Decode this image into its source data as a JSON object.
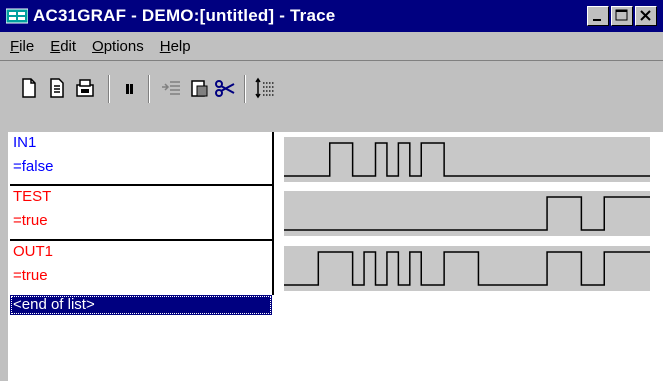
{
  "window": {
    "title": "AC31GRAF - DEMO:[untitled] - Trace"
  },
  "menu": [
    {
      "key": "F",
      "rest": "ile"
    },
    {
      "key": "E",
      "rest": "dit"
    },
    {
      "key": "O",
      "rest": "ptions"
    },
    {
      "key": "H",
      "rest": "elp"
    }
  ],
  "toolbar": {
    "icons": [
      "new-file-icon",
      "open-file-icon",
      "print-icon",
      "pause-icon",
      "insert-row-icon",
      "paste-icon",
      "cut-icon",
      "timescale-icon"
    ]
  },
  "signals": [
    {
      "name": "IN1",
      "value": "=false",
      "color": "#0000ff",
      "levels": [
        0,
        0,
        0,
        0,
        1,
        1,
        0,
        0,
        1,
        0,
        1,
        0,
        1,
        1,
        0,
        0,
        0,
        0,
        0,
        0,
        0,
        0,
        0,
        0,
        0,
        0,
        0,
        0,
        0,
        0,
        0,
        0
      ]
    },
    {
      "name": "TEST",
      "value": "=true",
      "color": "#ff0000",
      "levels": [
        0,
        0,
        0,
        0,
        0,
        0,
        0,
        0,
        0,
        0,
        0,
        0,
        0,
        0,
        0,
        0,
        0,
        0,
        0,
        0,
        0,
        0,
        0,
        1,
        1,
        1,
        0,
        0,
        1,
        1,
        1,
        1
      ]
    },
    {
      "name": "OUT1",
      "value": "=true",
      "color": "#ff0000",
      "levels": [
        0,
        0,
        0,
        1,
        1,
        1,
        0,
        1,
        0,
        1,
        0,
        1,
        0,
        0,
        1,
        1,
        1,
        0,
        0,
        0,
        0,
        0,
        0,
        1,
        1,
        1,
        0,
        0,
        1,
        1,
        1,
        1
      ]
    }
  ],
  "end_of_list": "<end of list>"
}
